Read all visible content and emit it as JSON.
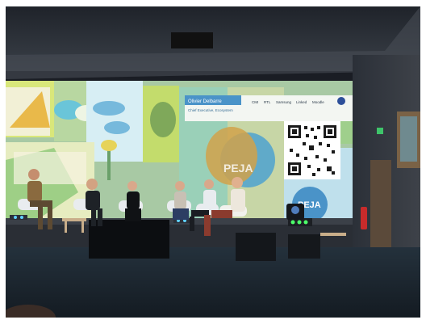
{
  "photo": {
    "description_free": true
  },
  "screen_overlay": {
    "speaker_name": "Olivier Delbarre",
    "speaker_role": "Chief Executive, Ecosystem",
    "partner_logos": [
      "CMI",
      "RTL",
      "Samsung",
      "Linked",
      "Moodle"
    ],
    "brand_text": "PEJA"
  },
  "colors": {
    "ceiling": "#2a2f36",
    "screen_green": "#cbe36a",
    "screen_blue": "#9ed0e8",
    "screen_panel": "#f5f7f4",
    "stage": "#202329",
    "floor": "#1c2731",
    "badge_blue": "#4a93c8"
  }
}
